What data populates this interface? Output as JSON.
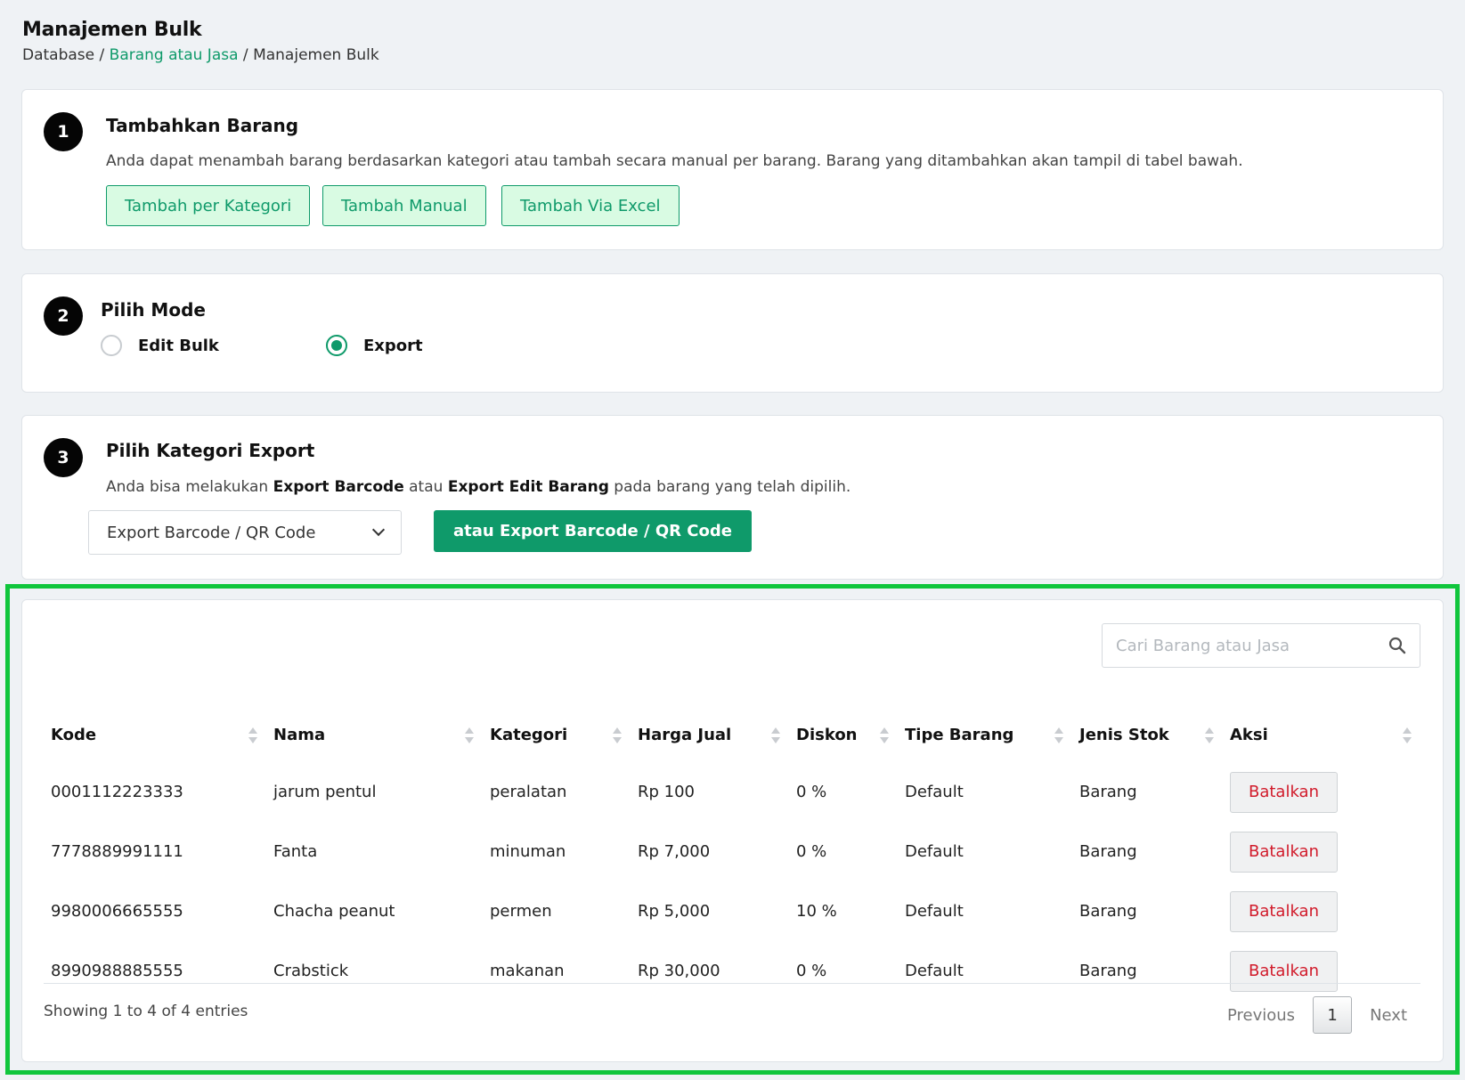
{
  "header": {
    "title": "Manajemen Bulk",
    "breadcrumb": [
      "Database",
      "Barang atau Jasa",
      "Manajemen Bulk"
    ],
    "separator": " / "
  },
  "step1": {
    "number": "1",
    "title": "Tambahkan Barang",
    "description": "Anda dapat menambah barang berdasarkan kategori atau tambah secara manual per barang. Barang yang ditambahkan akan tampil di tabel bawah.",
    "buttons": [
      "Tambah per Kategori",
      "Tambah Manual",
      "Tambah Via Excel"
    ]
  },
  "step2": {
    "number": "2",
    "title": "Pilih Mode",
    "options": [
      {
        "label": "Edit Bulk",
        "checked": false
      },
      {
        "label": "Export",
        "checked": true
      }
    ]
  },
  "step3": {
    "number": "3",
    "title": "Pilih Kategori Export",
    "desc_parts": [
      "Anda bisa melakukan ",
      "Export Barcode",
      " atau ",
      "Export Edit Barang",
      " pada barang yang telah dipilih."
    ],
    "select_value": "Export Barcode / QR Code",
    "action_label": "atau Export Barcode / QR Code"
  },
  "table": {
    "search_placeholder": "Cari Barang atau Jasa",
    "columns": [
      "Kode",
      "Nama",
      "Kategori",
      "Harga Jual",
      "Diskon",
      "Tipe Barang",
      "Jenis Stok",
      "Aksi"
    ],
    "rows": [
      {
        "kode": "0001112223333",
        "nama": "jarum pentul",
        "kategori": "peralatan",
        "harga": "Rp 100",
        "diskon": "0 %",
        "tipe": "Default",
        "jenis": "Barang",
        "aksi": "Batalkan"
      },
      {
        "kode": "7778889991111",
        "nama": "Fanta",
        "kategori": "minuman",
        "harga": "Rp 7,000",
        "diskon": "0 %",
        "tipe": "Default",
        "jenis": "Barang",
        "aksi": "Batalkan"
      },
      {
        "kode": "9980006665555",
        "nama": "Chacha peanut",
        "kategori": "permen",
        "harga": "Rp 5,000",
        "diskon": "10 %",
        "tipe": "Default",
        "jenis": "Barang",
        "aksi": "Batalkan"
      },
      {
        "kode": "8990988885555",
        "nama": "Crabstick",
        "kategori": "makanan",
        "harga": "Rp 30,000",
        "diskon": "0 %",
        "tipe": "Default",
        "jenis": "Barang",
        "aksi": "Batalkan"
      }
    ],
    "info": "Showing 1 to 4 of 4 entries",
    "pagination": {
      "previous": "Previous",
      "current": "1",
      "next": "Next"
    }
  },
  "colors": {
    "accent": "#0f9a6a",
    "highlight": "#10c63c",
    "danger": "#d11a2a"
  },
  "icons": {
    "search": "search-icon",
    "select": "chevron-down-icon",
    "sort": "sort-icon"
  }
}
